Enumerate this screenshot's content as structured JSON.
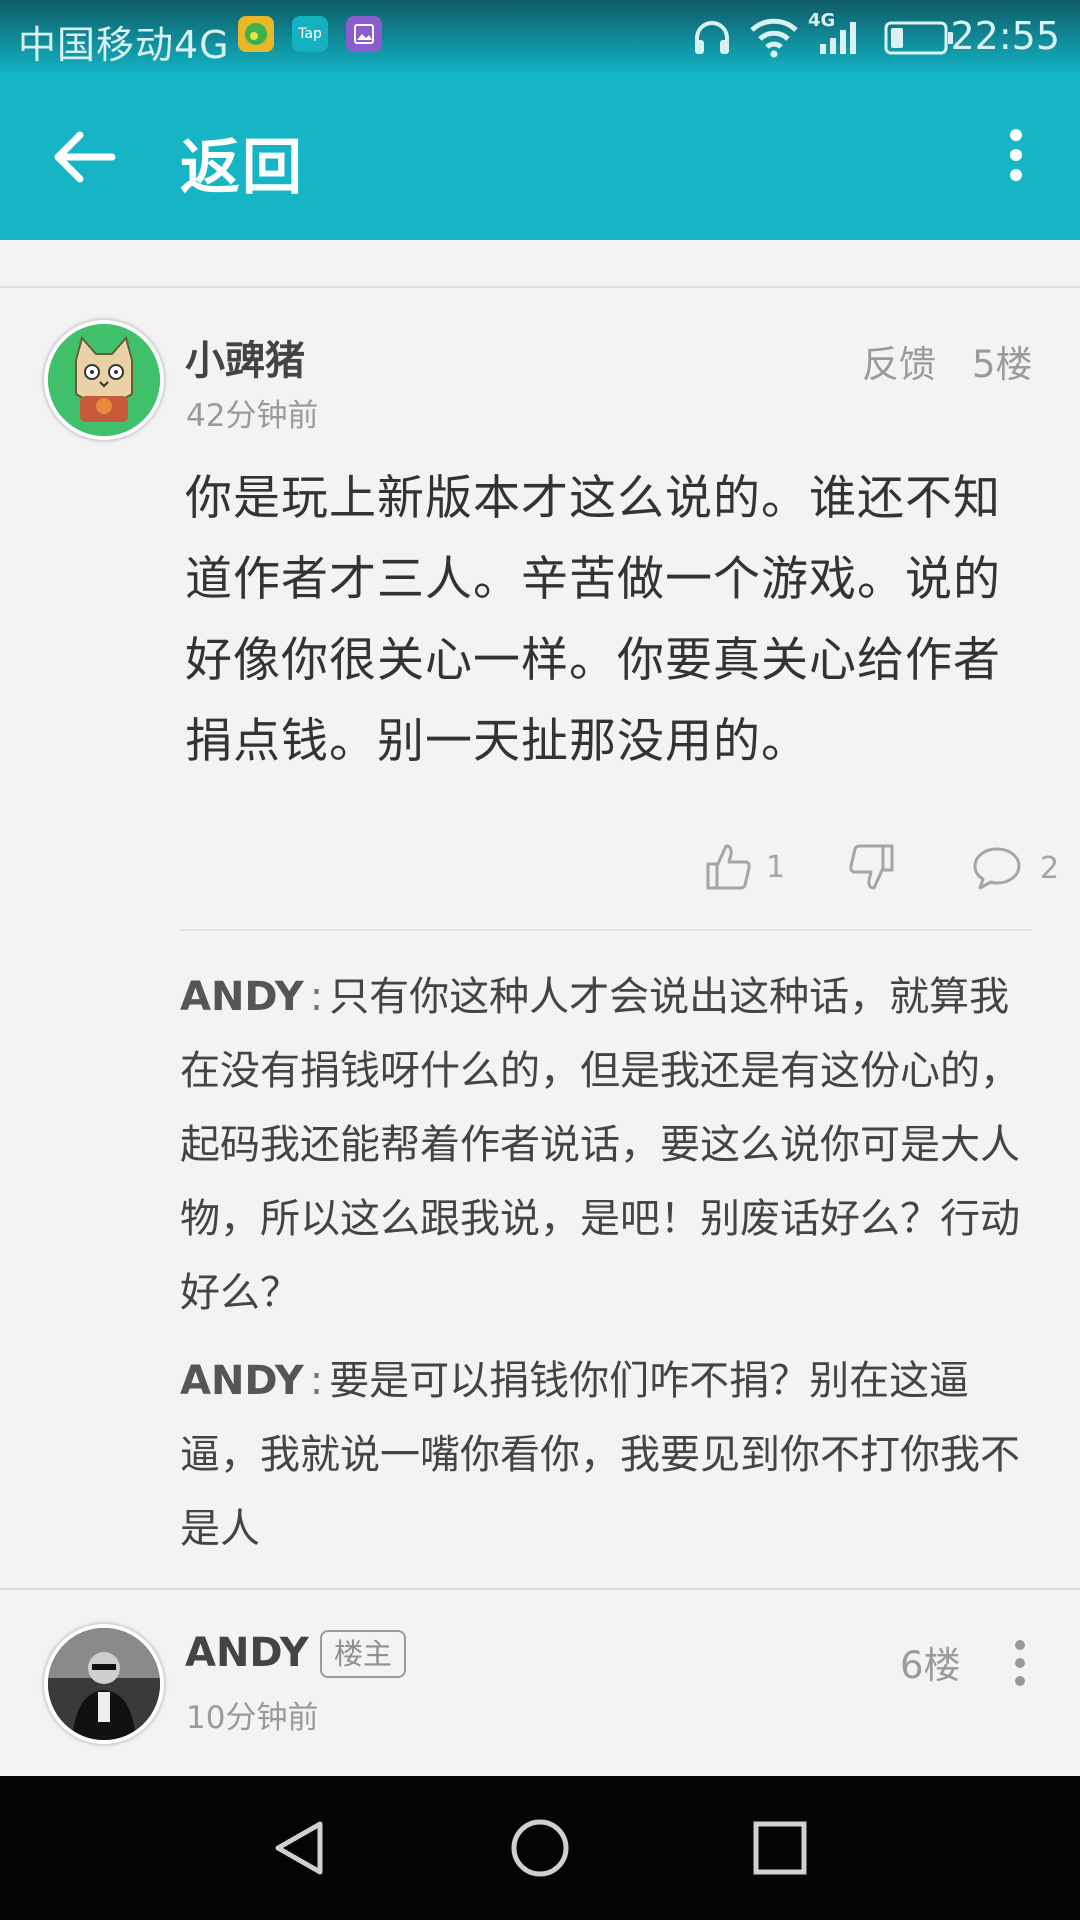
{
  "status_bar": {
    "carrier": "中国移动4G",
    "network_tag": "4G",
    "time": "22:55",
    "app_icons": [
      "qq-music-icon",
      "taptap-icon",
      "gallery-icon"
    ],
    "tap_label": "Tap"
  },
  "app_bar": {
    "title": "返回"
  },
  "comment_5": {
    "username": "小豍猪",
    "time": "42分钟前",
    "feedback": "反馈",
    "floor": "5楼",
    "body": "你是玩上新版本才这么说的。谁还不知道作者才三人。辛苦做一个游戏。说的好像你很关心一样。你要真关心给作者捐点钱。别一天扯那没用的。",
    "likes": "1",
    "replies_count": "2",
    "replies": [
      {
        "author": "ANDY",
        "colon": ":",
        "text": "只有你这种人才会说出这种话，就算我在没有捐钱呀什么的，但是我还是有这份心的，起码我还能帮着作者说话，要这么说你可是大人物，所以这么跟我说，是吧！别废话好么？行动好么？"
      },
      {
        "author": "ANDY",
        "colon": ":",
        "text": "要是可以捐钱你们咋不捐？别在这逼逼，我就说一嘴你看你，我要见到你不打你我不是人"
      }
    ]
  },
  "comment_6": {
    "username": "ANDY",
    "badge": "楼主",
    "time": "10分钟前",
    "floor": "6楼"
  },
  "colors": {
    "accent": "#15b5c6",
    "background": "#f3f3f3",
    "nav_bar": "#050505"
  }
}
